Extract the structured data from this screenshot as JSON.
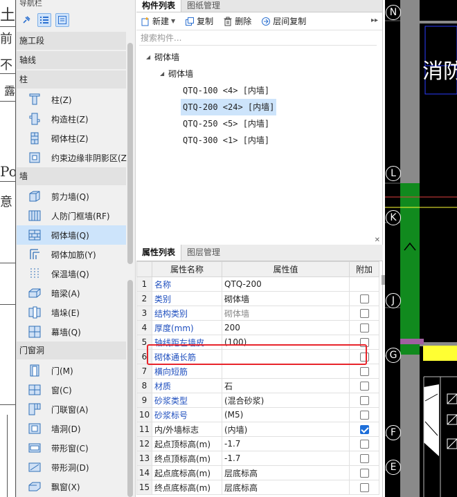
{
  "nav": {
    "header": "导航栏",
    "categories": {
      "construction_stage": "施工段",
      "axis": "轴线",
      "column": "柱",
      "wall": "墙",
      "door_window": "门窗洞"
    },
    "column_items": [
      "柱(Z)",
      "构造柱(Z)",
      "砌体柱(Z)",
      "约束边缘非阴影区(Z"
    ],
    "wall_items": [
      "剪力墙(Q)",
      "人防门框墙(RF)",
      "砌体墙(Q)",
      "砌体加筋(Y)",
      "保温墙(Q)",
      "暗梁(A)",
      "墙垛(E)",
      "幕墙(Q)"
    ],
    "door_items": [
      "门(M)",
      "窗(C)",
      "门联窗(A)",
      "墙洞(D)",
      "带形窗(C)",
      "带形洞(D)",
      "飘窗(X)"
    ]
  },
  "center": {
    "tabs": [
      "构件列表",
      "图纸管理"
    ],
    "toolbar": {
      "new": "新建",
      "copy": "复制",
      "delete": "删除",
      "layer_copy": "层间复制"
    },
    "search_placeholder": "搜索构件...",
    "tree": {
      "root": "砌体墙",
      "child": "砌体墙",
      "leaves": [
        "QTQ-100 <4> [内墙]",
        "QTQ-200 <24> [内墙]",
        "QTQ-250 <5> [内墙]",
        "QTQ-300 <1> [内墙]"
      ],
      "selected_index": 1
    }
  },
  "props": {
    "tabs": [
      "属性列表",
      "图层管理"
    ],
    "headers": [
      "属性名称",
      "属性值",
      "附加"
    ],
    "rows": [
      {
        "num": "1",
        "name": "名称",
        "value": "QTQ-200",
        "checkbox": false
      },
      {
        "num": "2",
        "name": "类别",
        "value": "砌体墙",
        "checkbox": true,
        "checked": false
      },
      {
        "num": "3",
        "name": "结构类别",
        "value": "砌体墙",
        "checkbox": true,
        "checked": false
      },
      {
        "num": "4",
        "name": "厚度(mm)",
        "value": "200",
        "checkbox": true,
        "checked": false
      },
      {
        "num": "5",
        "name": "轴线距左墙皮...",
        "value": "(100)",
        "checkbox": true,
        "checked": false
      },
      {
        "num": "6",
        "name": "砌体通长筋",
        "value": "",
        "checkbox": true,
        "checked": false
      },
      {
        "num": "7",
        "name": "横向短筋",
        "value": "",
        "checkbox": true,
        "checked": false
      },
      {
        "num": "8",
        "name": "材质",
        "value": "石",
        "checkbox": true,
        "checked": false
      },
      {
        "num": "9",
        "name": "砂浆类型",
        "value": "(混合砂浆)",
        "checkbox": true,
        "checked": false
      },
      {
        "num": "10",
        "name": "砂浆标号",
        "value": "(M5)",
        "checkbox": true,
        "checked": false
      },
      {
        "num": "11",
        "name": "内/外墙标志",
        "value": "(内墙)",
        "checkbox": true,
        "checked": true
      },
      {
        "num": "12",
        "name": "起点顶标高(m)",
        "value": "-1.7",
        "checkbox": true,
        "checked": false
      },
      {
        "num": "13",
        "name": "终点顶标高(m)",
        "value": "-1.7",
        "checkbox": true,
        "checked": false
      },
      {
        "num": "14",
        "name": "起点底标高(m)",
        "value": "层底标高",
        "checkbox": true,
        "checked": false
      },
      {
        "num": "15",
        "name": "终点底标高(m)",
        "value": "层底标高",
        "checkbox": true,
        "checked": false
      }
    ]
  },
  "cad": {
    "axis_labels": [
      "N",
      "L",
      "K",
      "J",
      "G",
      "F",
      "E"
    ],
    "text_fragment": "消防",
    "colors": {
      "wall_gray": "#8a8a8a",
      "green_fill": "#118a1e",
      "yellow": "#ffff33",
      "blue_line": "#2a3cff",
      "purple": "#a060a0"
    }
  },
  "left_strip": {
    "fragments": [
      "土",
      "前",
      "不",
      "露",
      "Po",
      "意"
    ]
  }
}
